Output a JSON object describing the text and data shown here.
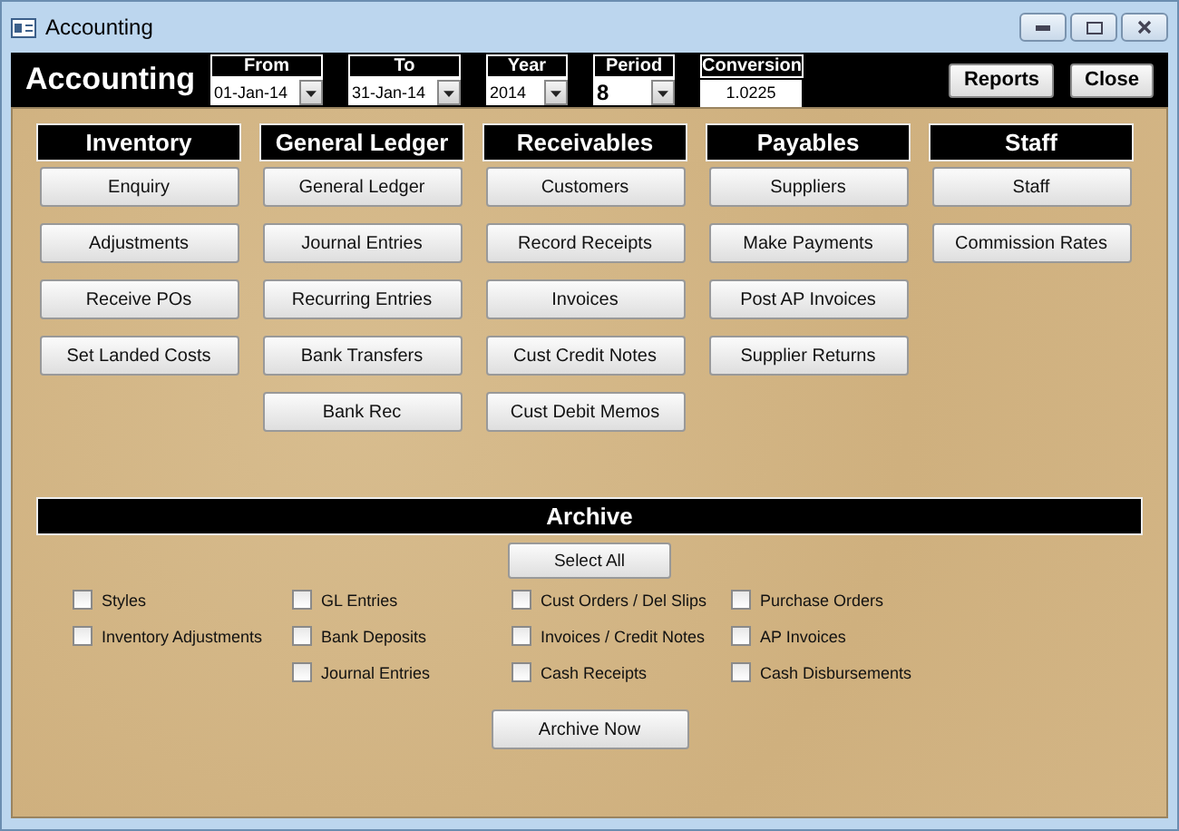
{
  "window": {
    "title": "Accounting"
  },
  "header": {
    "title": "Accounting",
    "filters": [
      {
        "label": "From",
        "value": "01-Jan-14",
        "kind": "dropdown",
        "bold": false
      },
      {
        "label": "To",
        "value": "31-Jan-14",
        "kind": "dropdown",
        "bold": false
      },
      {
        "label": "Year",
        "value": "2014",
        "kind": "dropdown",
        "bold": false
      },
      {
        "label": "Period",
        "value": "8",
        "kind": "dropdown",
        "bold": true
      },
      {
        "label": "Conversion",
        "value": "1.0225",
        "kind": "text",
        "bold": false
      }
    ],
    "buttons": [
      "Reports",
      "Close"
    ]
  },
  "sections": [
    {
      "title": "Inventory",
      "buttons": [
        "Enquiry",
        "Adjustments",
        "Receive POs",
        "Set Landed Costs"
      ]
    },
    {
      "title": "General Ledger",
      "buttons": [
        "General Ledger",
        "Journal Entries",
        "Recurring Entries",
        "Bank Transfers",
        "Bank Rec"
      ]
    },
    {
      "title": "Receivables",
      "buttons": [
        "Customers",
        "Record Receipts",
        "Invoices",
        "Cust Credit Notes",
        "Cust Debit Memos"
      ]
    },
    {
      "title": "Payables",
      "buttons": [
        "Suppliers",
        "Make Payments",
        "Post AP Invoices",
        "Supplier Returns"
      ]
    },
    {
      "title": "Staff",
      "buttons": [
        "Staff",
        "Commission Rates"
      ]
    }
  ],
  "archive": {
    "title": "Archive",
    "select_all": "Select All",
    "columns": [
      [
        {
          "label": "Styles",
          "checked": false
        },
        {
          "label": "Inventory Adjustments",
          "checked": false
        }
      ],
      [
        {
          "label": "GL Entries",
          "checked": false
        },
        {
          "label": "Bank Deposits",
          "checked": false
        },
        {
          "label": "Journal Entries",
          "checked": false
        }
      ],
      [
        {
          "label": "Cust Orders / Del Slips",
          "checked": false
        },
        {
          "label": "Invoices / Credit Notes",
          "checked": false
        },
        {
          "label": "Cash Receipts",
          "checked": false
        }
      ],
      [
        {
          "label": "Purchase Orders",
          "checked": false
        },
        {
          "label": "AP Invoices",
          "checked": false
        },
        {
          "label": "Cash Disbursements",
          "checked": false
        }
      ]
    ],
    "action": "Archive Now"
  }
}
